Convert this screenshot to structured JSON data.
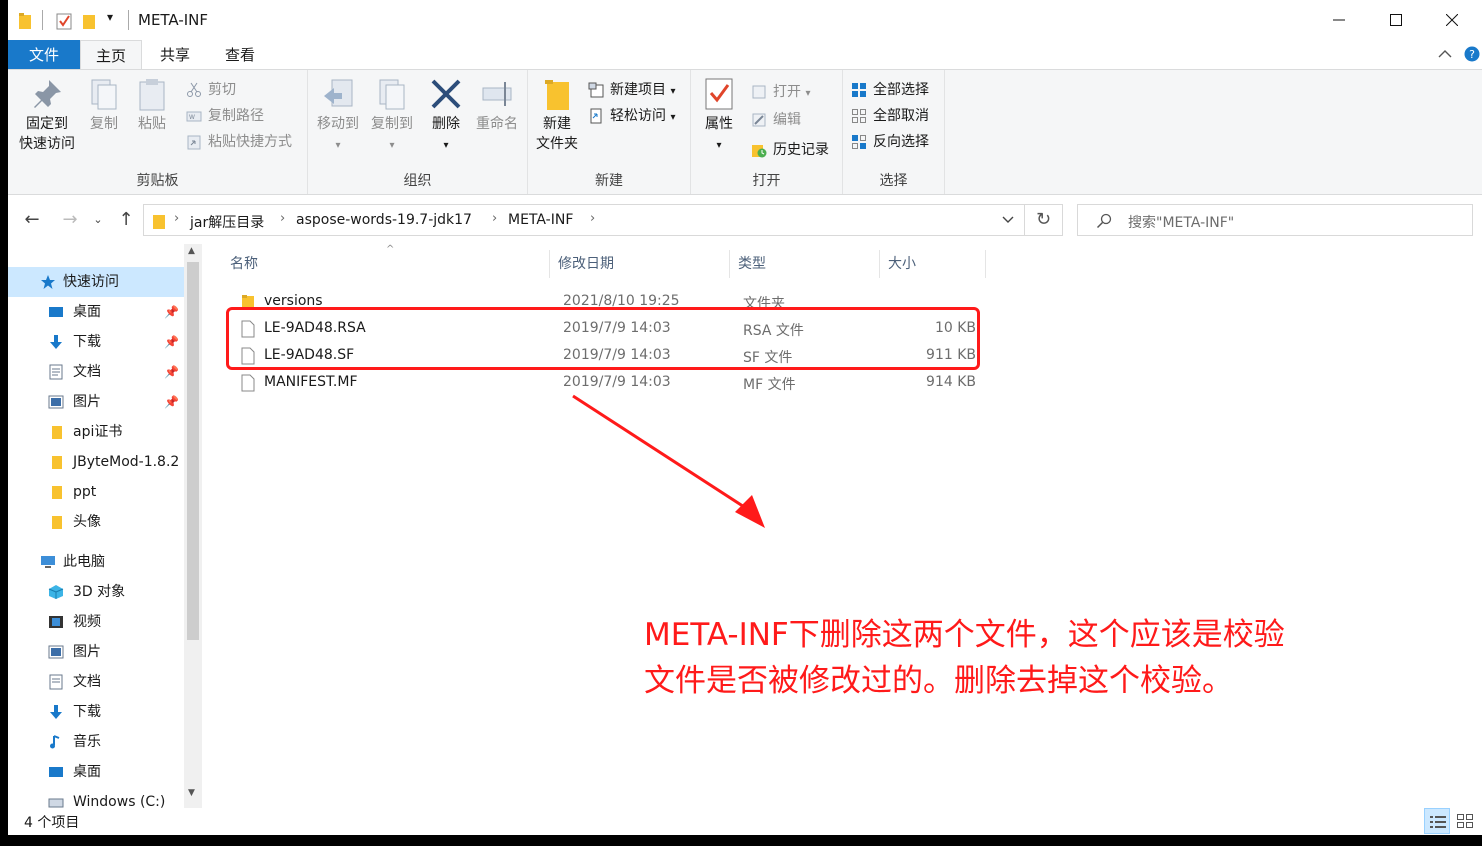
{
  "window": {
    "title": "META-INF",
    "qa_dropdown": "▾"
  },
  "tabs": {
    "file": "文件",
    "home": "主页",
    "share": "共享",
    "view": "查看"
  },
  "ribbon": {
    "clipboard": {
      "label": "剪贴板",
      "pin_line1": "固定到",
      "pin_line2": "快速访问",
      "copy": "复制",
      "paste": "粘贴",
      "cut": "剪切",
      "copy_path": "复制路径",
      "paste_shortcut": "粘贴快捷方式"
    },
    "organize": {
      "label": "组织",
      "move_to": "移动到",
      "copy_to": "复制到",
      "delete": "删除",
      "rename": "重命名"
    },
    "new": {
      "label": "新建",
      "new_folder_line1": "新建",
      "new_folder_line2": "文件夹",
      "new_item": "新建项目",
      "easy_access": "轻松访问"
    },
    "open": {
      "label": "打开",
      "properties": "属性",
      "open": "打开",
      "edit": "编辑",
      "history": "历史记录"
    },
    "select": {
      "label": "选择",
      "select_all": "全部选择",
      "select_none": "全部取消",
      "invert": "反向选择"
    }
  },
  "address": {
    "crumbs": [
      "jar解压目录",
      "aspose-words-19.7-jdk17",
      "META-INF"
    ],
    "search_placeholder": "搜索\"META-INF\""
  },
  "nav": {
    "quick_access": "快速访问",
    "quick_items": [
      "桌面",
      "下载",
      "文档",
      "图片",
      "api证书",
      "JByteMod-1.8.2",
      "ppt",
      "头像"
    ],
    "this_pc": "此电脑",
    "pc_items": [
      "3D 对象",
      "视频",
      "图片",
      "文档",
      "下载",
      "音乐",
      "桌面",
      "Windows (C:)"
    ]
  },
  "columns": {
    "name": "名称",
    "date": "修改日期",
    "type": "类型",
    "size": "大小"
  },
  "files": [
    {
      "name": "versions",
      "date": "2021/8/10 19:25",
      "type": "文件夹",
      "size": "",
      "icon": "folder-icon"
    },
    {
      "name": "LE-9AD48.RSA",
      "date": "2019/7/9 14:03",
      "type": "RSA 文件",
      "size": "10 KB",
      "icon": "file-icon"
    },
    {
      "name": "LE-9AD48.SF",
      "date": "2019/7/9 14:03",
      "type": "SF 文件",
      "size": "911 KB",
      "icon": "file-icon"
    },
    {
      "name": "MANIFEST.MF",
      "date": "2019/7/9 14:03",
      "type": "MF 文件",
      "size": "914 KB",
      "icon": "file-icon"
    }
  ],
  "annotation": {
    "line1": "META-INF下删除这两个文件，这个应该是校验",
    "line2": "文件是否被修改过的。删除去掉这个校验。",
    "color": "#ff1a1a"
  },
  "status": {
    "count": "4 个项目"
  },
  "colors": {
    "accent": "#1979ca",
    "selected": "#cce8ff",
    "folder": "#f8c22f"
  }
}
